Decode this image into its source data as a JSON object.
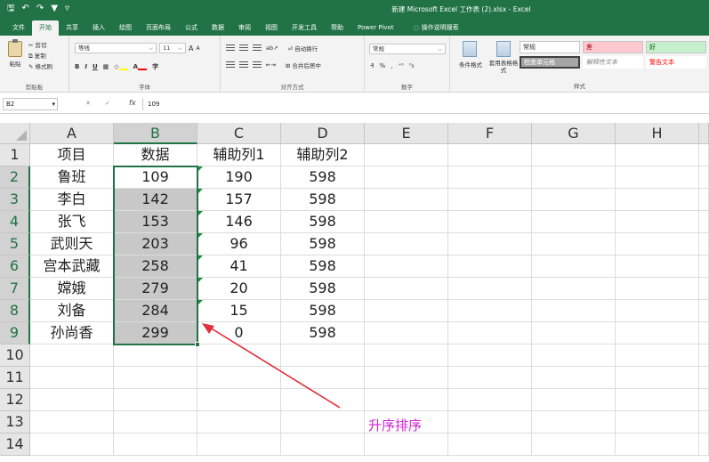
{
  "quick_access": {
    "save": "🖫",
    "undo": "↶",
    "redo": "↷",
    "filter": "▼",
    "more": "▿"
  },
  "window_title": "新建 Microsoft Excel 工作表 (2).xlsx  -  Excel",
  "tabs": [
    "文件",
    "开始",
    "共享",
    "插入",
    "绘图",
    "页面布局",
    "公式",
    "数据",
    "审阅",
    "视图",
    "开发工具",
    "帮助",
    "Power Pivot"
  ],
  "tell_me": "操作说明搜索",
  "ribbon": {
    "clipboard": {
      "paste": "粘贴",
      "cut": "剪切",
      "copy": "复制",
      "format_painter": "格式刷",
      "label": "剪贴板"
    },
    "font": {
      "name": "等线",
      "size": "11",
      "grow": "A",
      "shrink": "A",
      "bold": "B",
      "italic": "I",
      "underline": "U",
      "label": "字体"
    },
    "alignment": {
      "wrap": "自动换行",
      "merge": "合并后居中",
      "label": "对齐方式"
    },
    "number": {
      "format": "常规",
      "percent": "%",
      "comma": ",",
      "label": "数字"
    },
    "styles_group": {
      "cond_format": "条件格式",
      "table_format": "套用表格格式",
      "normal": "常规",
      "bad": "差",
      "good": "好",
      "check_cell": "检查单元格",
      "explanatory": "解释性文本",
      "warning": "警告文本",
      "label": "样式"
    },
    "colors": {
      "bad_bg": "#ffc7ce",
      "bad_fg": "#9c0006",
      "good_bg": "#c6efce",
      "good_fg": "#006100",
      "check_bg": "#a5a5a5",
      "warning_fg": "#ff0000"
    }
  },
  "formula_bar": {
    "name_box": "B2",
    "fx": "fx",
    "value": "109"
  },
  "columns": [
    "A",
    "B",
    "C",
    "D",
    "E",
    "F",
    "G",
    "H"
  ],
  "rows": [
    "1",
    "2",
    "3",
    "4",
    "5",
    "6",
    "7",
    "8",
    "9",
    "10",
    "11",
    "12",
    "13",
    "14"
  ],
  "sheet": [
    [
      "项目",
      "数据",
      "辅助列1",
      "辅助列2"
    ],
    [
      "鲁班",
      "109",
      "190",
      "598"
    ],
    [
      "李白",
      "142",
      "157",
      "598"
    ],
    [
      "张飞",
      "153",
      "146",
      "598"
    ],
    [
      "武则天",
      "203",
      "96",
      "598"
    ],
    [
      "宫本武藏",
      "258",
      "41",
      "598"
    ],
    [
      "嫦娥",
      "279",
      "20",
      "598"
    ],
    [
      "刘备",
      "284",
      "15",
      "598"
    ],
    [
      "孙尚香",
      "299",
      "0",
      "598"
    ]
  ],
  "annotation": "升序排序",
  "accent": "#217346",
  "annotation_color": "#d11fd1"
}
